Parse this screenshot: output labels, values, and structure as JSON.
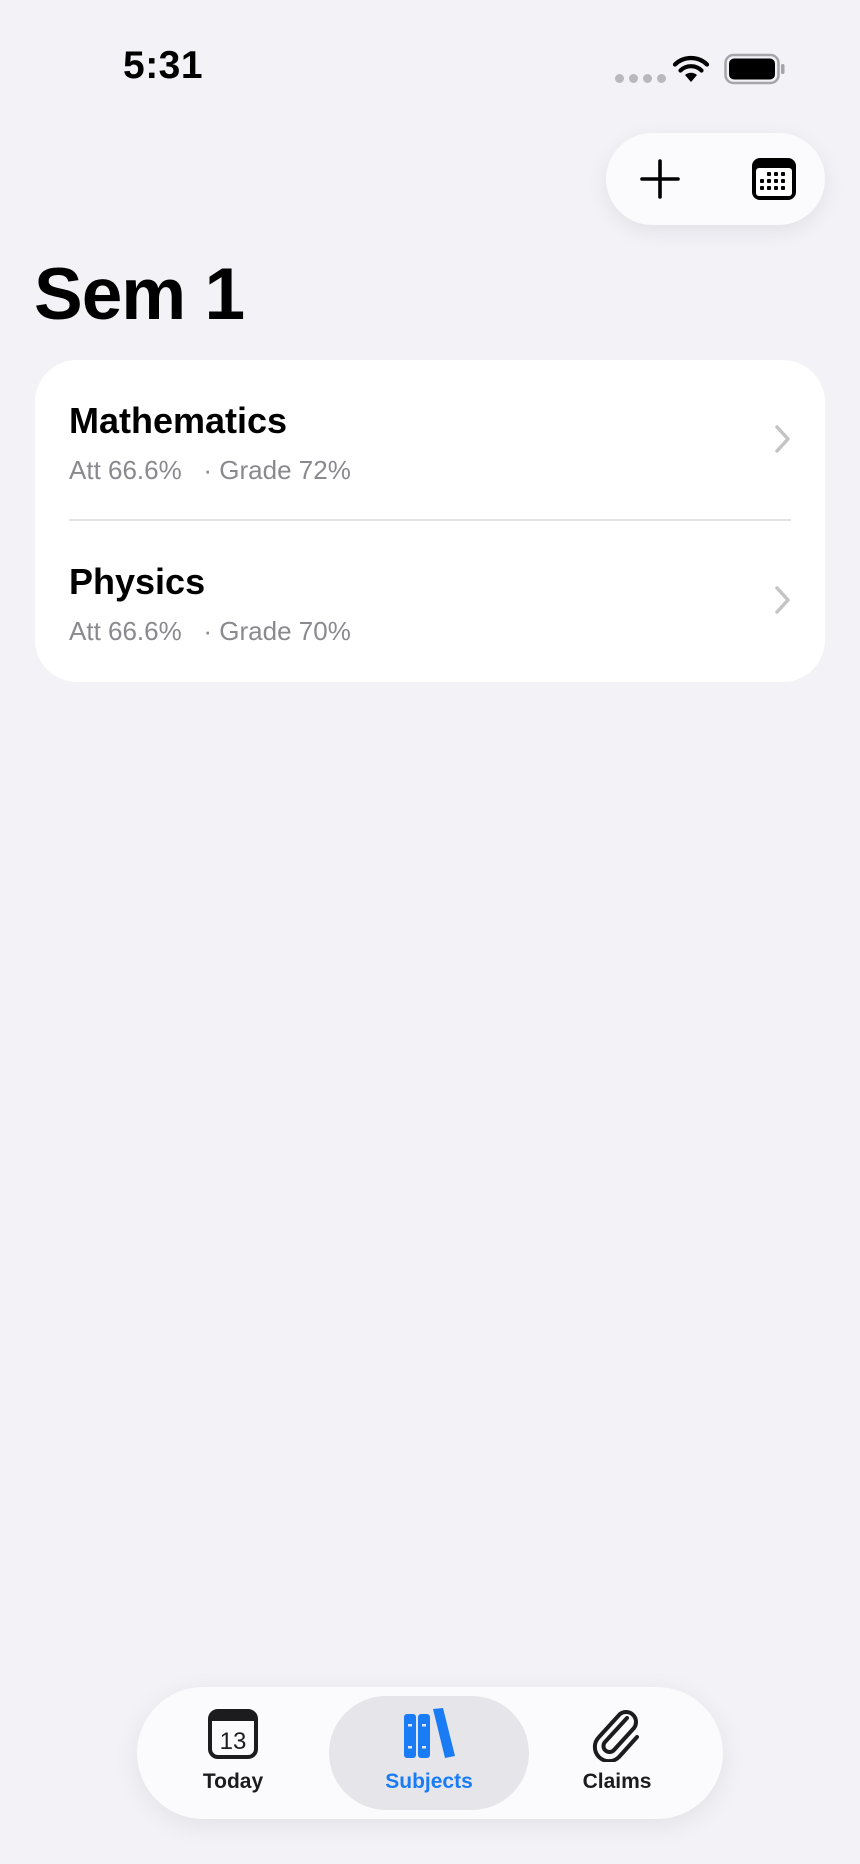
{
  "status_bar": {
    "time": "5:31"
  },
  "toolbar": {
    "add_icon": "plus-icon",
    "calendar_icon": "calendar-icon"
  },
  "page": {
    "title": "Sem 1"
  },
  "subjects": [
    {
      "name": "Mathematics",
      "attendance": "Att 66.6%",
      "grade": "· Grade 72%"
    },
    {
      "name": "Physics",
      "attendance": "Att 66.6%",
      "grade": "· Grade 70%"
    }
  ],
  "tab_bar": {
    "tabs": [
      {
        "label": "Today",
        "icon": "calendar-day-icon",
        "day": "13",
        "selected": false
      },
      {
        "label": "Subjects",
        "icon": "books-icon",
        "selected": true
      },
      {
        "label": "Claims",
        "icon": "paperclip-icon",
        "selected": false
      }
    ]
  },
  "colors": {
    "background": "#f2f2f7",
    "accent": "#1a7cf5",
    "secondary_text": "#8a8a8e"
  }
}
